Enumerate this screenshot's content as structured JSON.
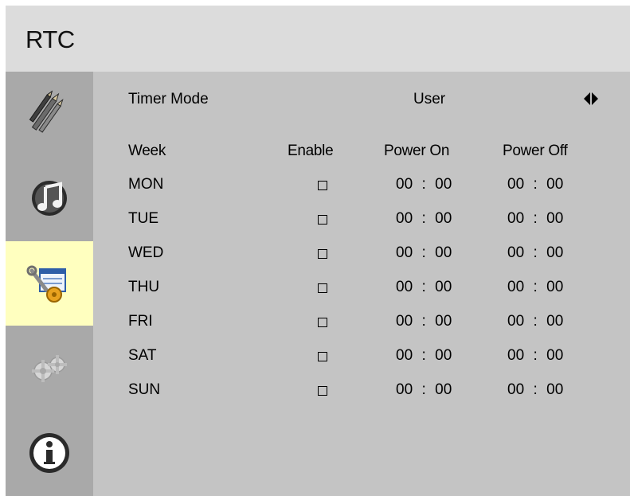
{
  "window": {
    "title": "RTC"
  },
  "sidebar": {
    "items": [
      {
        "icon": "pencils-icon",
        "active": false
      },
      {
        "icon": "music-note-icon",
        "active": false
      },
      {
        "icon": "settings-tools-icon",
        "active": true
      },
      {
        "icon": "gears-icon",
        "active": false
      },
      {
        "icon": "info-icon",
        "active": false
      }
    ]
  },
  "timer_mode": {
    "label": "Timer Mode",
    "value": "User",
    "arrow_icon": "left-right-arrow-icon"
  },
  "columns": {
    "week": "Week",
    "enable": "Enable",
    "power_on": "Power On",
    "power_off": "Power Off"
  },
  "days": [
    {
      "day": "MON",
      "on_h": "00",
      "on_m": "00",
      "off_h": "00",
      "off_m": "00"
    },
    {
      "day": "TUE",
      "on_h": "00",
      "on_m": "00",
      "off_h": "00",
      "off_m": "00"
    },
    {
      "day": "WED",
      "on_h": "00",
      "on_m": "00",
      "off_h": "00",
      "off_m": "00"
    },
    {
      "day": "THU",
      "on_h": "00",
      "on_m": "00",
      "off_h": "00",
      "off_m": "00"
    },
    {
      "day": "FRI",
      "on_h": "00",
      "on_m": "00",
      "off_h": "00",
      "off_m": "00"
    },
    {
      "day": "SAT",
      "on_h": "00",
      "on_m": "00",
      "off_h": "00",
      "off_m": "00"
    },
    {
      "day": "SUN",
      "on_h": "00",
      "on_m": "00",
      "off_h": "00",
      "off_m": "00"
    }
  ],
  "separator": ":",
  "colors": {
    "panel": "#c4c4c4",
    "header": "#dcdcdc",
    "sidebar": "#a9a9a9",
    "active_item": "#ffffbf"
  }
}
